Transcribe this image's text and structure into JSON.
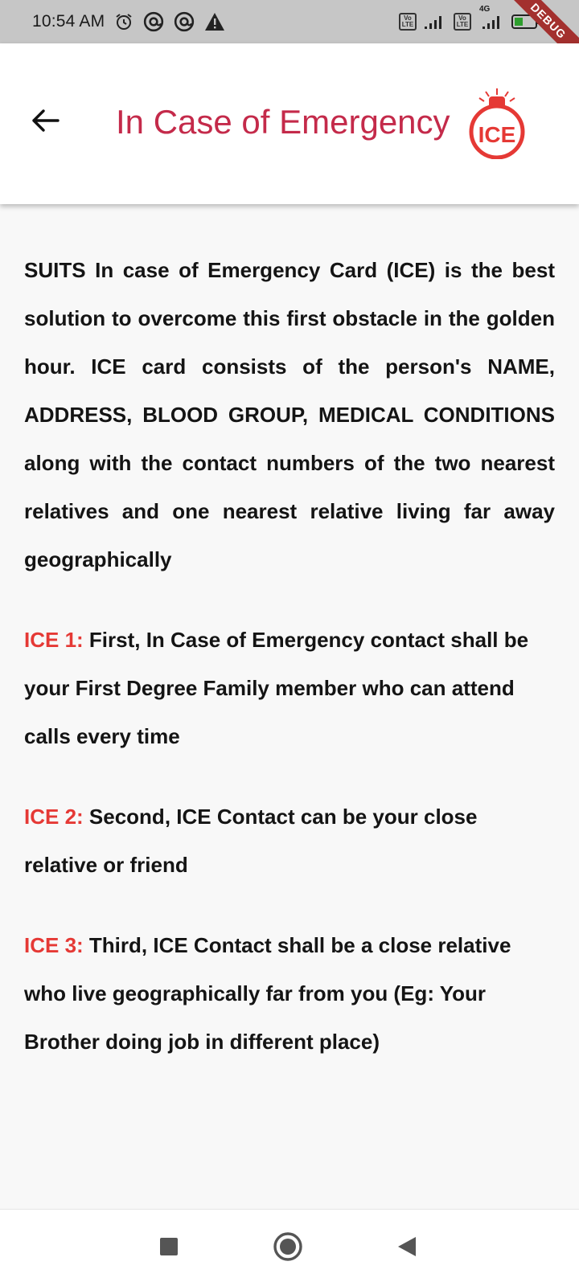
{
  "status_bar": {
    "time": "10:54 AM",
    "left_icons": [
      "alarm-icon",
      "at-sign-icon",
      "at-sign-icon",
      "warning-icon"
    ],
    "volte1_top": "Vo",
    "volte1_bottom": "LTE",
    "volte2_top": "Vo",
    "volte2_bottom": "LTE",
    "network_label": "4G",
    "debug_label": "DEBUG"
  },
  "app_bar": {
    "title": "In Case of Emergency",
    "logo_text": "ICE",
    "back_icon": "arrow-left-icon",
    "title_color": "#c42a4a"
  },
  "content": {
    "intro": "SUITS In case of Emergency Card (ICE) is the best solution to overcome this first obstacle in the golden hour. ICE card consists of the person's NAME, ADDRESS, BLOOD GROUP, MEDICAL CONDITIONS along with the contact numbers of the two nearest relatives and one nearest relative living far away geographically",
    "items": [
      {
        "label": "ICE 1:",
        "text": " First, In Case of Emergency contact shall be your First Degree Family member who can attend calls every time"
      },
      {
        "label": "ICE 2:",
        "text": " Second, ICE Contact can be your close relative or friend"
      },
      {
        "label": "ICE 3:",
        "text": " Third, ICE Contact shall be a close relative who live geographically far from you (Eg: Your Brother doing job in different place)"
      }
    ],
    "label_color": "#e53935"
  },
  "nav_bar": {
    "buttons": [
      "square-icon",
      "circle-home-icon",
      "triangle-back-icon"
    ]
  }
}
